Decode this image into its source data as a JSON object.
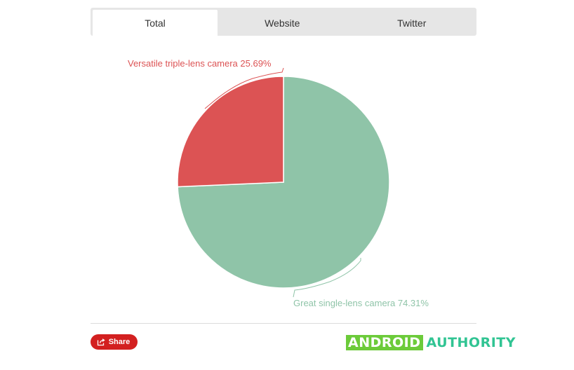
{
  "tabs": [
    {
      "label": "Total",
      "active": true
    },
    {
      "label": "Website",
      "active": false
    },
    {
      "label": "Twitter",
      "active": false
    }
  ],
  "chart_data": {
    "type": "pie",
    "slices": [
      {
        "label": "Great single-lens camera 74.31%",
        "value": 74.31,
        "color": "#8fc4a8"
      },
      {
        "label": "Versatile triple-lens camera 25.69%",
        "value": 25.69,
        "color": "#dc5354"
      }
    ],
    "start_angle_deg": 0,
    "direction": "clockwise"
  },
  "share": {
    "label": "Share",
    "icon": "share-icon"
  },
  "logo": {
    "part1": "ANDROID",
    "part2": "AUTHORITY"
  },
  "colors": {
    "share_bg": "#d32020",
    "logo_green": "#6ccb3a",
    "logo_teal": "#31c493"
  }
}
